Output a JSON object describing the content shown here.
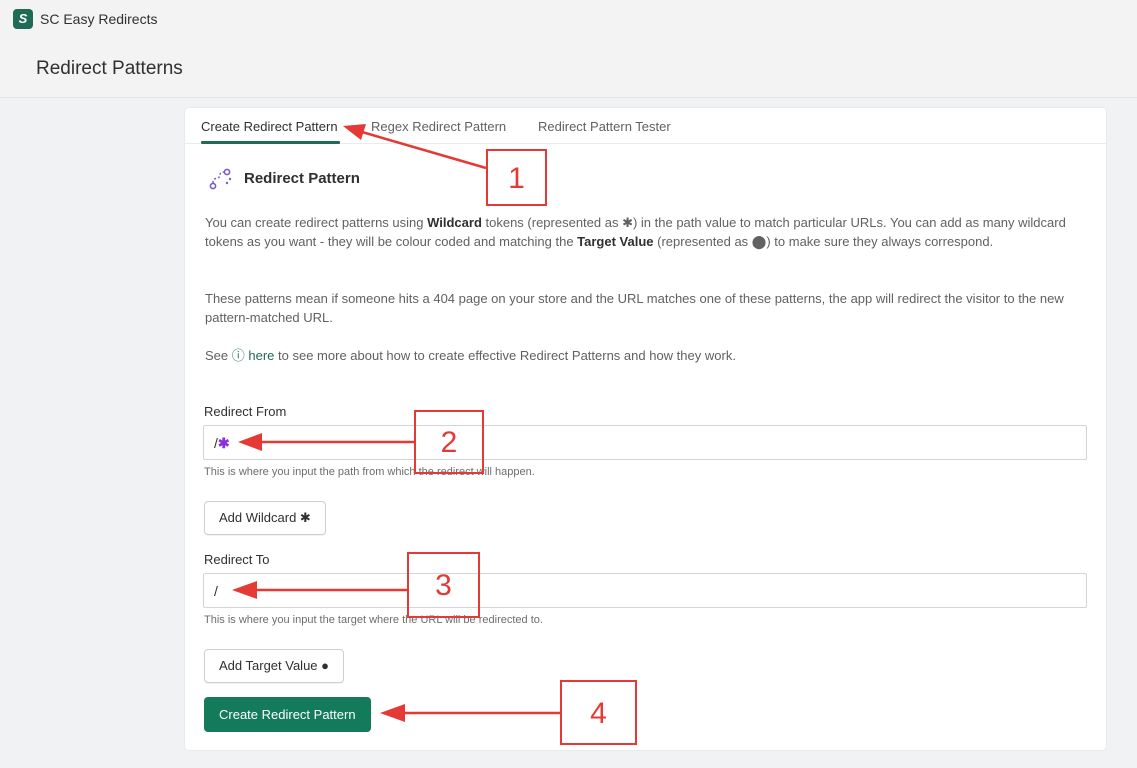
{
  "app": {
    "name": "SC Easy Redirects"
  },
  "page": {
    "title": "Redirect Patterns"
  },
  "tabs": [
    {
      "label": "Create Redirect Pattern",
      "active": true
    },
    {
      "label": "Regex Redirect Pattern",
      "active": false
    },
    {
      "label": "Redirect Pattern Tester",
      "active": false
    }
  ],
  "section": {
    "title": "Redirect Pattern",
    "para1": {
      "t1": "You can create redirect patterns using ",
      "b1": "Wildcard",
      "t2": " tokens (represented as ✱) in the path value to match particular URLs. You can add as many wildcard tokens as you want - they will be colour coded and matching the ",
      "b2": "Target Value",
      "t3": " (represented as ⬤) to make sure they always correspond."
    },
    "para2": "These patterns mean if someone hits a 404 page on your store and the URL matches one of these patterns, the app will redirect the visitor to the new pattern-matched URL.",
    "para3": {
      "prefix": "See ",
      "link_icon": "ⓘ",
      "link": "here",
      "suffix": " to see more about how to create effective Redirect Patterns and how they work."
    }
  },
  "form": {
    "redirect_from": {
      "label": "Redirect From",
      "value_prefix": "/",
      "value_wildcard": "✱",
      "help": "This is where you input the path from which the redirect will happen."
    },
    "add_wildcard_label": "Add Wildcard ✱",
    "redirect_to": {
      "label": "Redirect To",
      "value": "/",
      "help": "This is where you input the target where the URL will be redirected to."
    },
    "add_target_label": "Add Target Value ●",
    "submit_label": "Create Redirect Pattern"
  },
  "annotations": [
    "1",
    "2",
    "3",
    "4"
  ],
  "colors": {
    "accent": "#1f6b54",
    "primary_button": "#137a5a",
    "wildcard": "#8b2fe0",
    "annotation": "#e53935"
  }
}
